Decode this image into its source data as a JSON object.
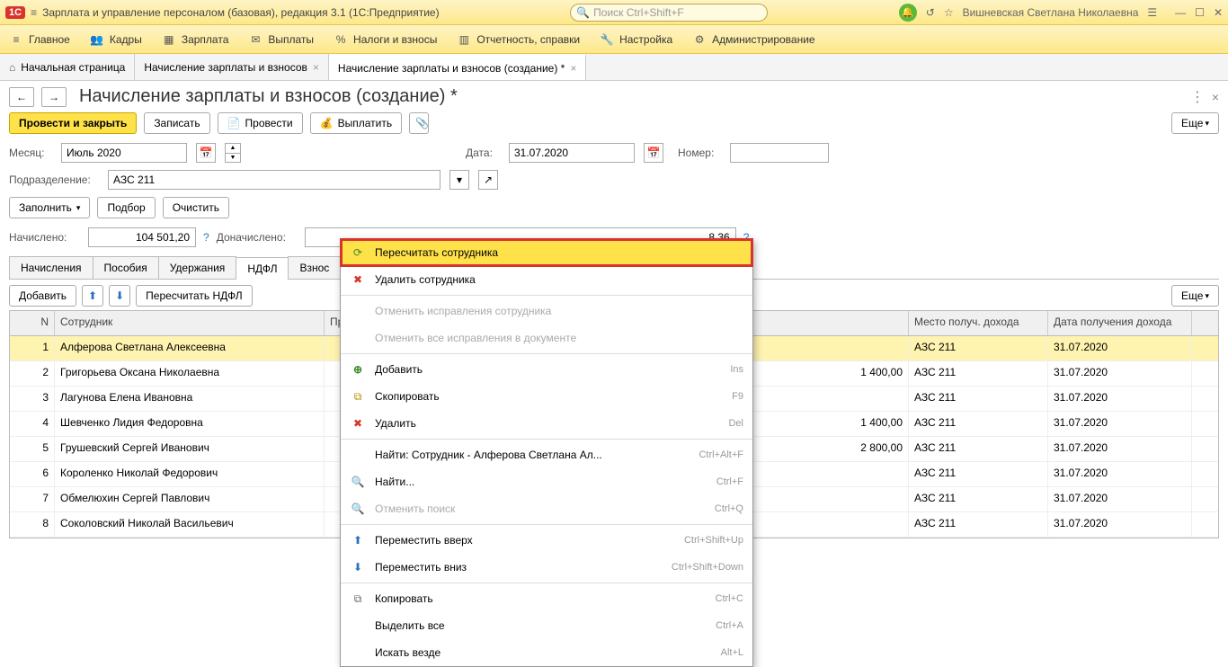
{
  "titlebar": {
    "app_title": "Зарплата и управление персоналом (базовая), редакция 3.1  (1С:Предприятие)",
    "search_placeholder": "Поиск Ctrl+Shift+F",
    "user": "Вишневская Светлана Николаевна"
  },
  "menu": {
    "main": "Главное",
    "kadry": "Кадры",
    "zarplata": "Зарплата",
    "vyplaty": "Выплаты",
    "nalogi": "Налоги и взносы",
    "otchet": "Отчетность, справки",
    "nastr": "Настройка",
    "admin": "Администрирование"
  },
  "tabs": {
    "home": "Начальная страница",
    "t1": "Начисление зарплаты и взносов",
    "t2": "Начисление зарплаты и взносов (создание) *"
  },
  "doc": {
    "title": "Начисление зарплаты и взносов (создание) *",
    "post_close": "Провести и закрыть",
    "save": "Записать",
    "post": "Провести",
    "pay": "Выплатить",
    "more": "Еще",
    "month_lbl": "Месяц:",
    "month_val": "Июль 2020",
    "date_lbl": "Дата:",
    "date_val": "31.07.2020",
    "num_lbl": "Номер:",
    "subdiv_lbl": "Подразделение:",
    "subdiv_val": "АЗС 211",
    "fill": "Заполнить",
    "pick": "Подбор",
    "clear": "Очистить",
    "accr_lbl": "Начислено:",
    "accr_val": "104 501,20",
    "dop_lbl": "Доначислено:",
    "right_val": "8,36"
  },
  "subtabs": {
    "t1": "Начисления",
    "t2": "Пособия",
    "t3": "Удержания",
    "t4": "НДФЛ",
    "t5": "Взнос"
  },
  "tblbar": {
    "add": "Добавить",
    "recalc": "Пересчитать НДФЛ",
    "more": "Еще"
  },
  "cols": {
    "n": "N",
    "emp": "Сотрудник",
    "ded": "Примененные вычеты",
    "place": "Место получ. дохода",
    "date": "Дата получения дохода"
  },
  "rows": [
    {
      "n": "1",
      "emp": "Алферова Светлана Алексеевна",
      "ded": "",
      "place": "АЗС 211",
      "date": "31.07.2020"
    },
    {
      "n": "2",
      "emp": "Григорьева Оксана Николаевна",
      "ded": "1 400,00",
      "place": "АЗС 211",
      "date": "31.07.2020"
    },
    {
      "n": "3",
      "emp": "Лагунова Елена Ивановна",
      "ded": "",
      "place": "АЗС 211",
      "date": "31.07.2020"
    },
    {
      "n": "4",
      "emp": "Шевченко Лидия Федоровна",
      "ded": "1 400,00",
      "place": "АЗС 211",
      "date": "31.07.2020"
    },
    {
      "n": "5",
      "emp": "Грушевский Сергей Иванович",
      "ded": "2 800,00",
      "place": "АЗС 211",
      "date": "31.07.2020"
    },
    {
      "n": "6",
      "emp": "Короленко Николай Федорович",
      "ded": "",
      "place": "АЗС 211",
      "date": "31.07.2020"
    },
    {
      "n": "7",
      "emp": "Обмелюхин Сергей Павлович",
      "ded": "",
      "place": "АЗС 211",
      "date": "31.07.2020"
    },
    {
      "n": "8",
      "emp": "Соколовский Николай Васильевич",
      "ded": "",
      "place": "АЗС 211",
      "date": "31.07.2020"
    }
  ],
  "ctx": {
    "recalc_emp": "Пересчитать сотрудника",
    "del_emp": "Удалить сотрудника",
    "cancel_emp": "Отменить исправления сотрудника",
    "cancel_all": "Отменить все исправления в документе",
    "add": "Добавить",
    "add_sc": "Ins",
    "copy": "Скопировать",
    "copy_sc": "F9",
    "del": "Удалить",
    "del_sc": "Del",
    "find_exact": "Найти: Сотрудник - Алферова Светлана Ал...",
    "find_exact_sc": "Ctrl+Alt+F",
    "find": "Найти...",
    "find_sc": "Ctrl+F",
    "cancel_find": "Отменить поиск",
    "cancel_find_sc": "Ctrl+Q",
    "move_up": "Переместить вверх",
    "move_up_sc": "Ctrl+Shift+Up",
    "move_down": "Переместить вниз",
    "move_down_sc": "Ctrl+Shift+Down",
    "copy2": "Копировать",
    "copy2_sc": "Ctrl+C",
    "select_all": "Выделить все",
    "select_all_sc": "Ctrl+A",
    "search_all": "Искать везде",
    "search_all_sc": "Alt+L"
  }
}
